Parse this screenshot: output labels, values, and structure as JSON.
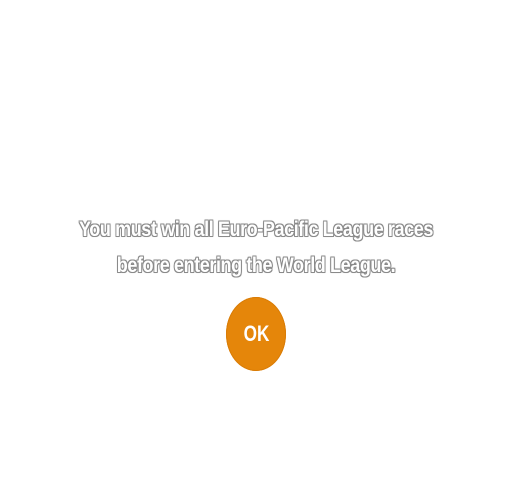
{
  "dialog": {
    "message_line1": "You must win all Euro-Pacific League races",
    "message_line2": "before entering the World League.",
    "ok_label": "OK"
  },
  "colors": {
    "background": "#ffffff",
    "button": "#e5860a",
    "text_outline": "#8a8a8a"
  }
}
